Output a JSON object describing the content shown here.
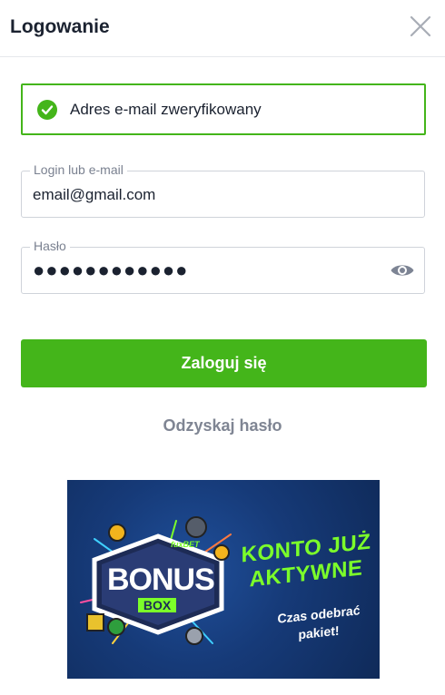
{
  "header": {
    "title": "Logowanie"
  },
  "verified_notice": {
    "text": "Adres e-mail zweryfikowany"
  },
  "login_field": {
    "label": "Login lub e-mail",
    "value": "email@gmail.com"
  },
  "password_field": {
    "label": "Hasło",
    "masked_value": "●●●●●●●●●●●●"
  },
  "actions": {
    "login_label": "Zaloguj się",
    "recover_label": "Odzyskaj hasło"
  },
  "banner": {
    "logo_text": "BONUS",
    "logo_sub": "BOX",
    "logo_brand": "fuxBET",
    "headline_1": "KONTO JUŻ",
    "headline_2": "AKTYWNE",
    "subtitle_1": "Czas odebrać",
    "subtitle_2": "pakiet!"
  },
  "colors": {
    "accent": "#44b51a",
    "text": "#1b2230",
    "muted": "#7f8593",
    "banner_bg": "#163a78",
    "banner_green": "#7cff2a"
  }
}
